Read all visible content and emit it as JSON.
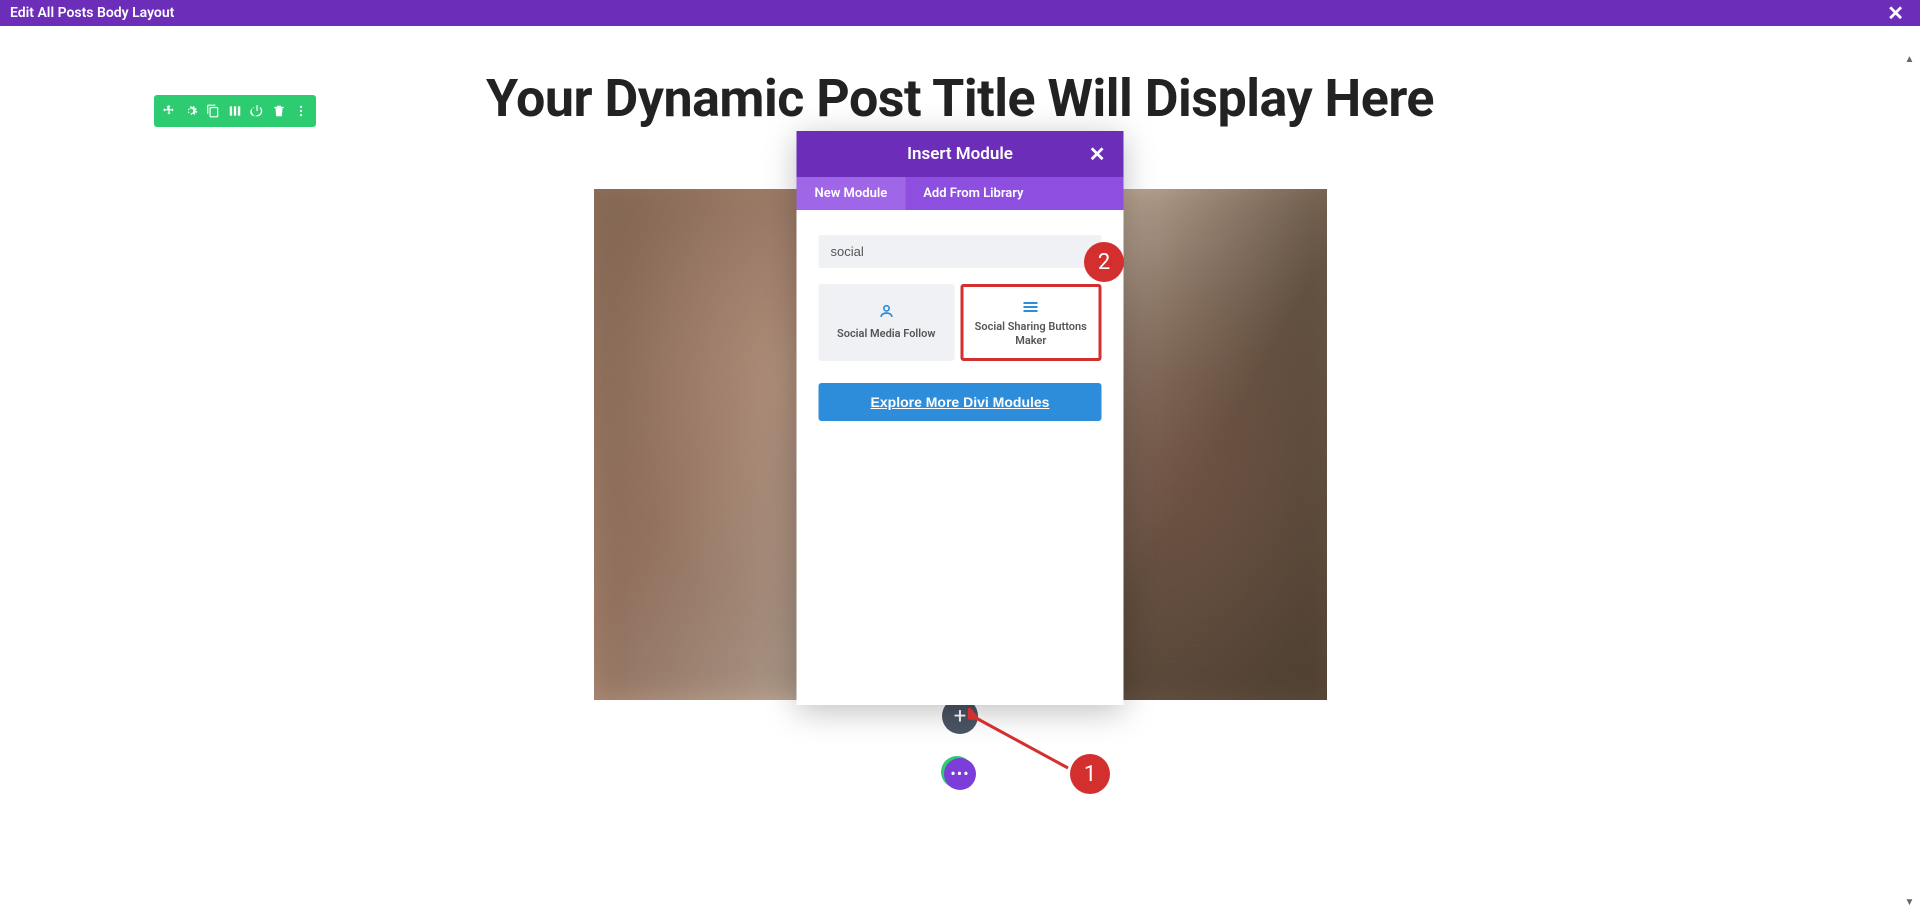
{
  "top_bar": {
    "title": "Edit All Posts Body Layout"
  },
  "page": {
    "title": "Your Dynamic Post Title Will Display Here"
  },
  "toolbar": {
    "icons": [
      "move-icon",
      "gear-icon",
      "duplicate-icon",
      "columns-icon",
      "power-icon",
      "trash-icon",
      "more-icon"
    ]
  },
  "add_button": {
    "label": "+"
  },
  "more_button": {
    "label": "•••"
  },
  "modal": {
    "title": "Insert Module",
    "tabs": {
      "new": "New Module",
      "library": "Add From Library"
    },
    "search_value": "social",
    "modules": {
      "follow": "Social Media Follow",
      "sharing": "Social Sharing Buttons Maker"
    },
    "explore": "Explore More Divi Modules"
  },
  "annotations": {
    "badge1": "1",
    "badge2": "2"
  }
}
